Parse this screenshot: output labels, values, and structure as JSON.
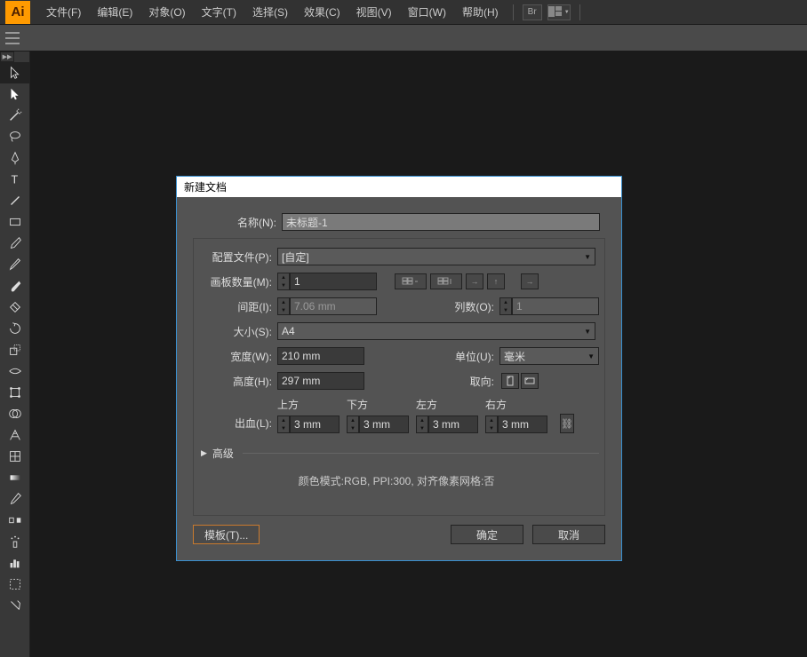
{
  "app_logo": "Ai",
  "menus": [
    "文件(F)",
    "编辑(E)",
    "对象(O)",
    "文字(T)",
    "选择(S)",
    "效果(C)",
    "视图(V)",
    "窗口(W)",
    "帮助(H)"
  ],
  "menubar_br": "Br",
  "dialog": {
    "title": "新建文档",
    "name_label": "名称(N):",
    "name_value": "未标题-1",
    "profile_label": "配置文件(P):",
    "profile_value": "[自定]",
    "artboards_label": "画板数量(M):",
    "artboards_value": "1",
    "spacing_label": "间距(I):",
    "spacing_value": "7.06 mm",
    "columns_label": "列数(O):",
    "columns_value": "1",
    "size_label": "大小(S):",
    "size_value": "A4",
    "width_label": "宽度(W):",
    "width_value": "210 mm",
    "units_label": "单位(U):",
    "units_value": "毫米",
    "height_label": "高度(H):",
    "height_value": "297 mm",
    "orient_label": "取向:",
    "bleed_label": "出血(L):",
    "bleed_top": "上方",
    "bleed_bottom": "下方",
    "bleed_left": "左方",
    "bleed_right": "右方",
    "bleed_value": "3 mm",
    "advanced": "高级",
    "info": "颜色模式:RGB, PPI:300, 对齐像素网格:否",
    "template_btn": "模板(T)...",
    "ok_btn": "确定",
    "cancel_btn": "取消"
  }
}
